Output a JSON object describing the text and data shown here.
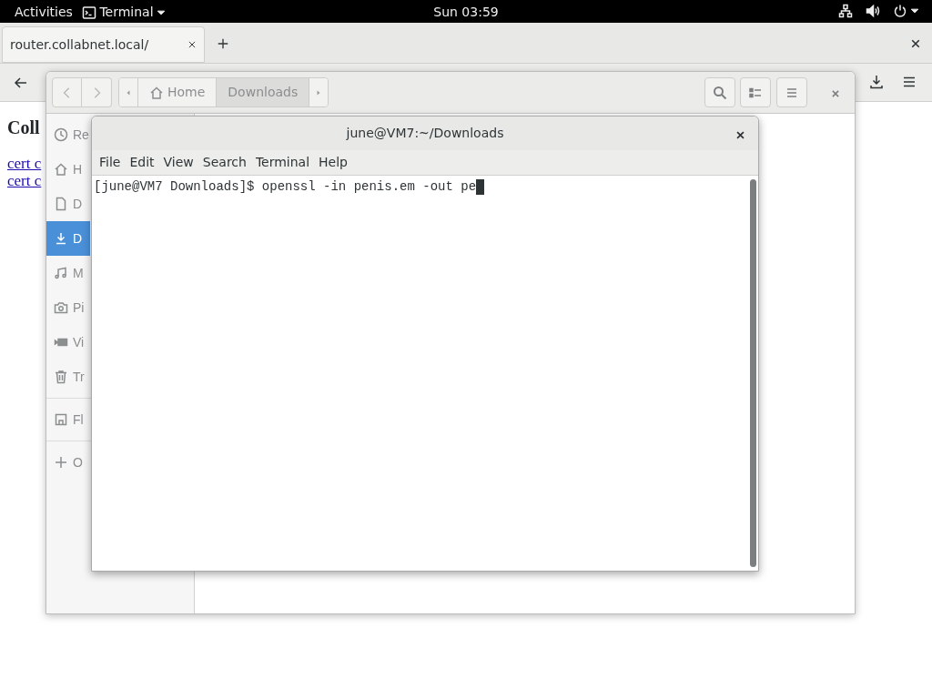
{
  "top_bar": {
    "activities": "Activities",
    "app_menu": "Terminal",
    "clock": "Sun 03:59"
  },
  "browser": {
    "tabs": [
      {
        "title": "router.collabnet.local/",
        "selected": true
      }
    ],
    "page": {
      "heading": "Coll",
      "links": [
        "cert c",
        "cert c"
      ]
    }
  },
  "files": {
    "path": [
      {
        "label": "Home",
        "kind": "home",
        "selected": false
      },
      {
        "label": "Downloads",
        "kind": "folder",
        "selected": true
      }
    ],
    "sidebar": {
      "places": [
        {
          "label": "Re",
          "kind": "clock",
          "selected": false
        },
        {
          "label": "H",
          "kind": "home",
          "selected": false
        },
        {
          "label": "D",
          "kind": "document",
          "selected": false
        },
        {
          "label": "D",
          "kind": "download",
          "selected": true
        },
        {
          "label": "M",
          "kind": "music",
          "selected": false
        },
        {
          "label": "Pi",
          "kind": "camera",
          "selected": false
        },
        {
          "label": "Vi",
          "kind": "video",
          "selected": false
        },
        {
          "label": "Tr",
          "kind": "trash",
          "selected": false
        }
      ],
      "devices": [
        {
          "label": "Fl",
          "kind": "drive",
          "selected": false
        }
      ],
      "other": [
        {
          "label": "O",
          "kind": "plus",
          "selected": false
        }
      ]
    }
  },
  "terminal": {
    "title": "june@VM7:~/Downloads",
    "menu": [
      "File",
      "Edit",
      "View",
      "Search",
      "Terminal",
      "Help"
    ],
    "lines": [
      "[june@VM7 Downloads]$ openssl -in penis.em -out pe"
    ]
  }
}
